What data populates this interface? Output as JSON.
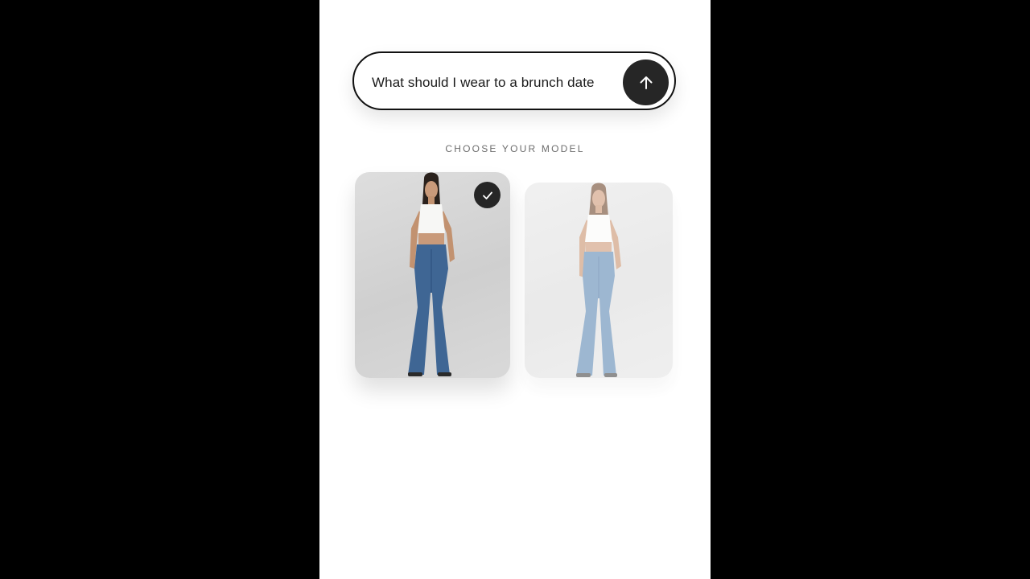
{
  "prompt": {
    "text": "What should I wear to a brunch date"
  },
  "send_button": {
    "icon": "arrow-up-icon"
  },
  "model_picker": {
    "label": "CHOOSE YOUR MODEL",
    "models": [
      {
        "image": "model-photo-white-crop-top-flare-jeans",
        "selected": true
      },
      {
        "image": "model-photo-white-crop-top-flare-jeans",
        "selected": false
      }
    ]
  },
  "colors": {
    "background": "#000000",
    "panel": "#ffffff",
    "accent_dark": "#262626"
  }
}
